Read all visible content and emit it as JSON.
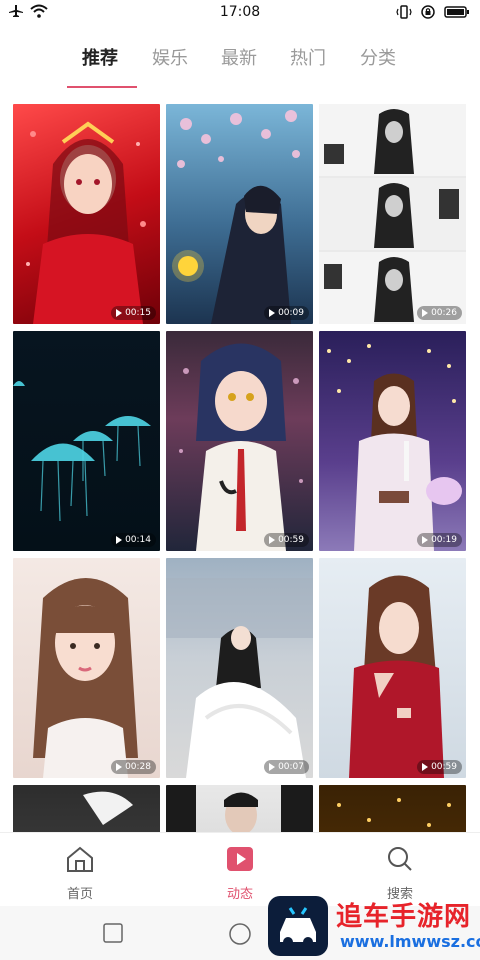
{
  "status": {
    "time": "17:08"
  },
  "tabs": [
    {
      "label": "推荐",
      "active": true
    },
    {
      "label": "娱乐",
      "active": false
    },
    {
      "label": "最新",
      "active": false
    },
    {
      "label": "热门",
      "active": false
    },
    {
      "label": "分类",
      "active": false
    }
  ],
  "videos": [
    {
      "duration": "00:15",
      "theme": "red-anime-girl"
    },
    {
      "duration": "00:09",
      "theme": "anime-boy-cherry-blossom"
    },
    {
      "duration": "00:26",
      "theme": "monochrome-anime"
    },
    {
      "duration": "00:14",
      "theme": "jellyfish"
    },
    {
      "duration": "00:59",
      "theme": "anime-girl-rain"
    },
    {
      "duration": "00:19",
      "theme": "singer-night-lights"
    },
    {
      "duration": "00:28",
      "theme": "girl-portrait"
    },
    {
      "duration": "00:07",
      "theme": "white-dress-dancer"
    },
    {
      "duration": "00:59",
      "theme": "red-dress-woman"
    },
    {
      "duration": "",
      "theme": "partial-dark"
    },
    {
      "duration": "",
      "theme": "partial-man"
    },
    {
      "duration": "",
      "theme": "partial-gold"
    }
  ],
  "bottom_nav": [
    {
      "label": "首页",
      "icon": "home-icon",
      "active": false
    },
    {
      "label": "动态",
      "icon": "play-icon",
      "active": true
    },
    {
      "label": "搜索",
      "icon": "search-icon",
      "active": false
    }
  ],
  "watermark": {
    "big": "追车手游网",
    "small": "www.lmwwsz.com"
  }
}
